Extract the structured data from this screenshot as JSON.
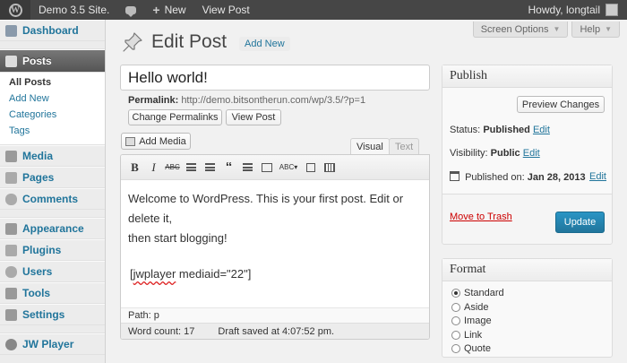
{
  "admin_bar": {
    "site_name": "Demo 3.5 Site.",
    "new_label": "New",
    "view_post_label": "View Post",
    "greeting": "Howdy, longtail"
  },
  "sidebar": {
    "items": [
      {
        "label": "Dashboard",
        "icon": "dashboard-icon"
      },
      {
        "label": "Posts",
        "icon": "pin-icon"
      },
      {
        "label": "Media",
        "icon": "media-icon"
      },
      {
        "label": "Pages",
        "icon": "pages-icon"
      },
      {
        "label": "Comments",
        "icon": "comments-icon"
      },
      {
        "label": "Appearance",
        "icon": "appearance-icon"
      },
      {
        "label": "Plugins",
        "icon": "plugins-icon"
      },
      {
        "label": "Users",
        "icon": "users-icon"
      },
      {
        "label": "Tools",
        "icon": "tools-icon"
      },
      {
        "label": "Settings",
        "icon": "settings-icon"
      },
      {
        "label": "JW Player",
        "icon": "play-icon"
      }
    ],
    "posts_submenu": [
      "All Posts",
      "Add New",
      "Categories",
      "Tags"
    ]
  },
  "header": {
    "title": "Edit Post",
    "add_new": "Add New",
    "screen_options": "Screen Options",
    "help": "Help"
  },
  "post": {
    "title": "Hello world!",
    "permalink_label": "Permalink:",
    "permalink_url": "http://demo.bitsontherun.com/wp/3.5/?p=1",
    "change_permalinks": "Change Permalinks",
    "view_post": "View Post"
  },
  "editor": {
    "add_media": "Add Media",
    "tab_visual": "Visual",
    "tab_text": "Text",
    "content_line1": "Welcome to WordPress. This is your first post. Edit or delete it,",
    "content_line2": "then start blogging!",
    "shortcode_pre": "[",
    "shortcode_word": "jwplayer",
    "shortcode_post": " mediaid=\"22\"]",
    "path": "Path: p",
    "word_count": "Word count: 17",
    "draft_saved": "Draft saved at 4:07:52 pm."
  },
  "publish": {
    "title": "Publish",
    "preview": "Preview Changes",
    "status_label": "Status:",
    "status_value": "Published",
    "visibility_label": "Visibility:",
    "visibility_value": "Public",
    "published_label": "Published on:",
    "published_value": "Jan 28, 2013",
    "edit": "Edit",
    "trash": "Move to Trash",
    "update": "Update"
  },
  "format": {
    "title": "Format",
    "options": [
      "Standard",
      "Aside",
      "Image",
      "Link",
      "Quote"
    ],
    "selected": "Standard"
  },
  "colors": {
    "accent": "#21759b",
    "admin_bar": "#464646",
    "update_button": "#21759b",
    "trash": "#cc0000"
  }
}
